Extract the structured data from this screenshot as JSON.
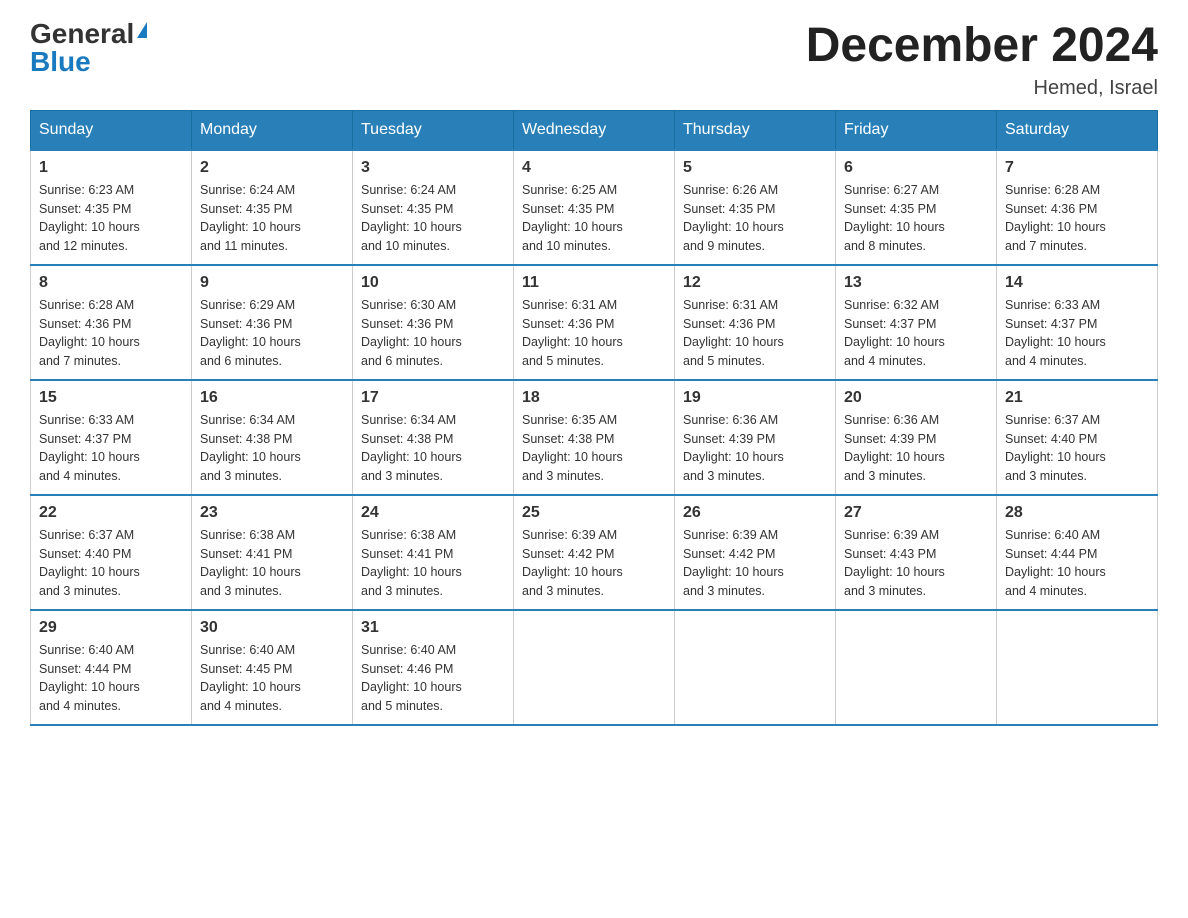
{
  "header": {
    "logo_general": "General",
    "logo_blue": "Blue",
    "month_title": "December 2024",
    "location": "Hemed, Israel"
  },
  "weekdays": [
    "Sunday",
    "Monday",
    "Tuesday",
    "Wednesday",
    "Thursday",
    "Friday",
    "Saturday"
  ],
  "weeks": [
    [
      {
        "day": "1",
        "sunrise": "6:23 AM",
        "sunset": "4:35 PM",
        "daylight": "10 hours and 12 minutes."
      },
      {
        "day": "2",
        "sunrise": "6:24 AM",
        "sunset": "4:35 PM",
        "daylight": "10 hours and 11 minutes."
      },
      {
        "day": "3",
        "sunrise": "6:24 AM",
        "sunset": "4:35 PM",
        "daylight": "10 hours and 10 minutes."
      },
      {
        "day": "4",
        "sunrise": "6:25 AM",
        "sunset": "4:35 PM",
        "daylight": "10 hours and 10 minutes."
      },
      {
        "day": "5",
        "sunrise": "6:26 AM",
        "sunset": "4:35 PM",
        "daylight": "10 hours and 9 minutes."
      },
      {
        "day": "6",
        "sunrise": "6:27 AM",
        "sunset": "4:35 PM",
        "daylight": "10 hours and 8 minutes."
      },
      {
        "day": "7",
        "sunrise": "6:28 AM",
        "sunset": "4:36 PM",
        "daylight": "10 hours and 7 minutes."
      }
    ],
    [
      {
        "day": "8",
        "sunrise": "6:28 AM",
        "sunset": "4:36 PM",
        "daylight": "10 hours and 7 minutes."
      },
      {
        "day": "9",
        "sunrise": "6:29 AM",
        "sunset": "4:36 PM",
        "daylight": "10 hours and 6 minutes."
      },
      {
        "day": "10",
        "sunrise": "6:30 AM",
        "sunset": "4:36 PM",
        "daylight": "10 hours and 6 minutes."
      },
      {
        "day": "11",
        "sunrise": "6:31 AM",
        "sunset": "4:36 PM",
        "daylight": "10 hours and 5 minutes."
      },
      {
        "day": "12",
        "sunrise": "6:31 AM",
        "sunset": "4:36 PM",
        "daylight": "10 hours and 5 minutes."
      },
      {
        "day": "13",
        "sunrise": "6:32 AM",
        "sunset": "4:37 PM",
        "daylight": "10 hours and 4 minutes."
      },
      {
        "day": "14",
        "sunrise": "6:33 AM",
        "sunset": "4:37 PM",
        "daylight": "10 hours and 4 minutes."
      }
    ],
    [
      {
        "day": "15",
        "sunrise": "6:33 AM",
        "sunset": "4:37 PM",
        "daylight": "10 hours and 4 minutes."
      },
      {
        "day": "16",
        "sunrise": "6:34 AM",
        "sunset": "4:38 PM",
        "daylight": "10 hours and 3 minutes."
      },
      {
        "day": "17",
        "sunrise": "6:34 AM",
        "sunset": "4:38 PM",
        "daylight": "10 hours and 3 minutes."
      },
      {
        "day": "18",
        "sunrise": "6:35 AM",
        "sunset": "4:38 PM",
        "daylight": "10 hours and 3 minutes."
      },
      {
        "day": "19",
        "sunrise": "6:36 AM",
        "sunset": "4:39 PM",
        "daylight": "10 hours and 3 minutes."
      },
      {
        "day": "20",
        "sunrise": "6:36 AM",
        "sunset": "4:39 PM",
        "daylight": "10 hours and 3 minutes."
      },
      {
        "day": "21",
        "sunrise": "6:37 AM",
        "sunset": "4:40 PM",
        "daylight": "10 hours and 3 minutes."
      }
    ],
    [
      {
        "day": "22",
        "sunrise": "6:37 AM",
        "sunset": "4:40 PM",
        "daylight": "10 hours and 3 minutes."
      },
      {
        "day": "23",
        "sunrise": "6:38 AM",
        "sunset": "4:41 PM",
        "daylight": "10 hours and 3 minutes."
      },
      {
        "day": "24",
        "sunrise": "6:38 AM",
        "sunset": "4:41 PM",
        "daylight": "10 hours and 3 minutes."
      },
      {
        "day": "25",
        "sunrise": "6:39 AM",
        "sunset": "4:42 PM",
        "daylight": "10 hours and 3 minutes."
      },
      {
        "day": "26",
        "sunrise": "6:39 AM",
        "sunset": "4:42 PM",
        "daylight": "10 hours and 3 minutes."
      },
      {
        "day": "27",
        "sunrise": "6:39 AM",
        "sunset": "4:43 PM",
        "daylight": "10 hours and 3 minutes."
      },
      {
        "day": "28",
        "sunrise": "6:40 AM",
        "sunset": "4:44 PM",
        "daylight": "10 hours and 4 minutes."
      }
    ],
    [
      {
        "day": "29",
        "sunrise": "6:40 AM",
        "sunset": "4:44 PM",
        "daylight": "10 hours and 4 minutes."
      },
      {
        "day": "30",
        "sunrise": "6:40 AM",
        "sunset": "4:45 PM",
        "daylight": "10 hours and 4 minutes."
      },
      {
        "day": "31",
        "sunrise": "6:40 AM",
        "sunset": "4:46 PM",
        "daylight": "10 hours and 5 minutes."
      },
      null,
      null,
      null,
      null
    ]
  ],
  "labels": {
    "sunrise": "Sunrise:",
    "sunset": "Sunset:",
    "daylight": "Daylight:"
  }
}
